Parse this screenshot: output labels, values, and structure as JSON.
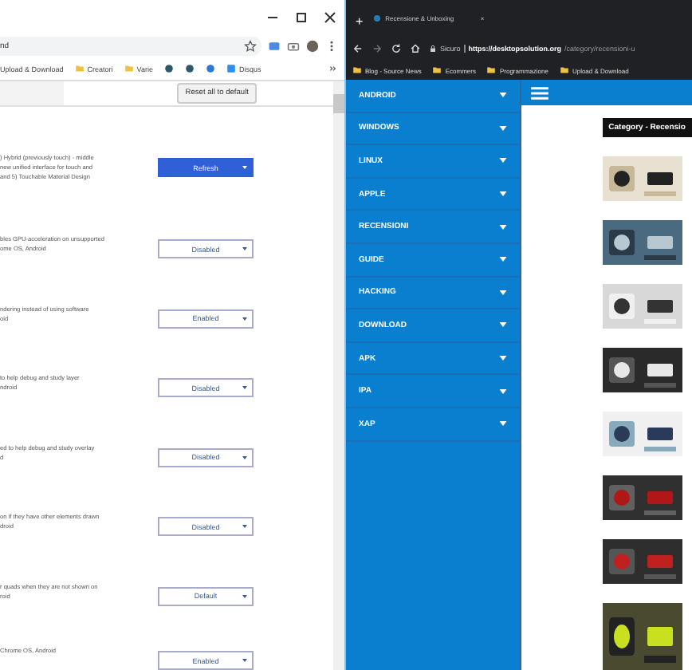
{
  "left_window": {
    "address_text": "nd",
    "bookmarks": [
      {
        "label": "Upload & Download",
        "kind": "plain"
      },
      {
        "label": "Creatori",
        "kind": "folder"
      },
      {
        "label": "Varie",
        "kind": "folder"
      },
      {
        "label": "Disqus",
        "kind": "site"
      }
    ],
    "reset_button": "Reset all to default",
    "flags": [
      {
        "lines": [
          ") Hybrid (previously touch) - middle",
          "new unified interface for touch and",
          "and 5) Touchable Material Design"
        ],
        "value": "Refresh",
        "highlighted": true
      },
      {
        "lines": [
          "bles GPU-acceleration on unsupported",
          "ome OS, Android"
        ],
        "value": "Disabled",
        "highlighted": false
      },
      {
        "lines": [
          "ndering instead of using software",
          "oid"
        ],
        "value": "Enabled",
        "highlighted": false
      },
      {
        "lines": [
          "to help debug and study layer",
          "ndroid"
        ],
        "value": "Disabled",
        "highlighted": false
      },
      {
        "lines": [
          "ed to help debug and study overlay",
          "d"
        ],
        "value": "Disabled",
        "highlighted": false
      },
      {
        "lines": [
          "on if they have other elements drawn",
          "droid"
        ],
        "value": "Disabled",
        "highlighted": false
      },
      {
        "lines": [
          "r quads when they are not shown on",
          "roid"
        ],
        "value": "Default",
        "highlighted": false
      },
      {
        "lines": [
          "Chrome OS, Android"
        ],
        "value": "Enabled",
        "highlighted": false
      }
    ]
  },
  "right_window": {
    "new_tab": "+",
    "tab": {
      "title": "Recensione & Unboxing",
      "close": "×"
    },
    "address": {
      "security": "Sicuro",
      "host": "https://desktopsolution.org",
      "path": "/category/recensioni-u"
    },
    "bookmarks": [
      "Blog - Source News",
      "Ecommers",
      "Programmazione",
      "Upload & Download"
    ],
    "sidebar": {
      "items": [
        "ANDROID",
        "WINDOWS",
        "LINUX",
        "APPLE",
        "RECENSIONI",
        "GUIDE",
        "HACKING",
        "DOWNLOAD",
        "APK",
        "IPA",
        "XAP"
      ]
    },
    "category_label": "Category - Recensio"
  }
}
